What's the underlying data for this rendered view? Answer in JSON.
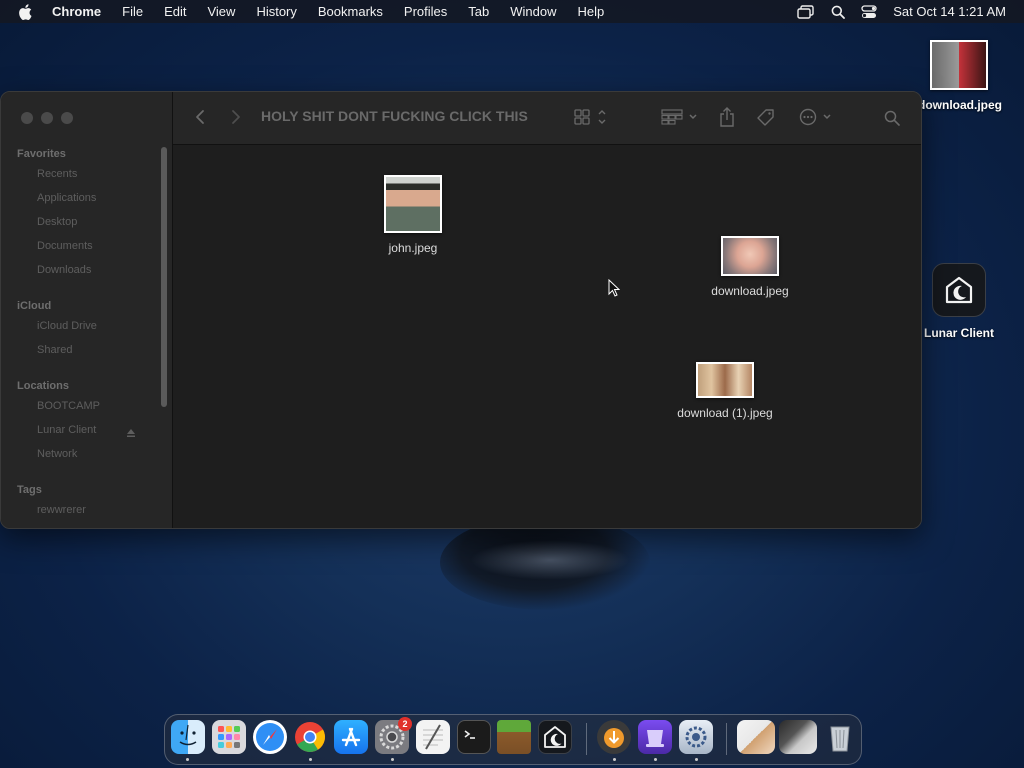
{
  "menubar": {
    "app_name": "Chrome",
    "items": [
      "File",
      "Edit",
      "View",
      "History",
      "Bookmarks",
      "Profiles",
      "Tab",
      "Window",
      "Help"
    ],
    "clock": "Sat Oct 14  1:21 AM"
  },
  "desktop": {
    "icons": [
      {
        "label": "download.jpeg"
      },
      {
        "label": "Lunar Client"
      }
    ]
  },
  "finder": {
    "title": "HOLY SHIT DONT FUCKING CLICK THIS",
    "sidebar": {
      "favorites_label": "Favorites",
      "favorites": [
        "Recents",
        "Applications",
        "Desktop",
        "Documents",
        "Downloads"
      ],
      "icloud_label": "iCloud",
      "icloud": [
        "iCloud Drive",
        "Shared"
      ],
      "locations_label": "Locations",
      "locations": [
        "BOOTCAMP",
        "Lunar Client",
        "Network"
      ],
      "tags_label": "Tags",
      "tags": [
        "rewwrerer"
      ]
    },
    "files": [
      {
        "name": "john.jpeg"
      },
      {
        "name": "download.jpeg"
      },
      {
        "name": "download (1).jpeg"
      }
    ]
  },
  "dock": {
    "apps": [
      "finder",
      "launchpad",
      "safari",
      "chrome",
      "app-store",
      "system-settings",
      "textedit",
      "terminal",
      "minecraft",
      "lunar-client",
      "downloader",
      "installer",
      "utility"
    ],
    "settings_badge": "2"
  },
  "colors": {
    "accent_blue": "#1e7bf0",
    "badge_red": "#e0302a"
  }
}
